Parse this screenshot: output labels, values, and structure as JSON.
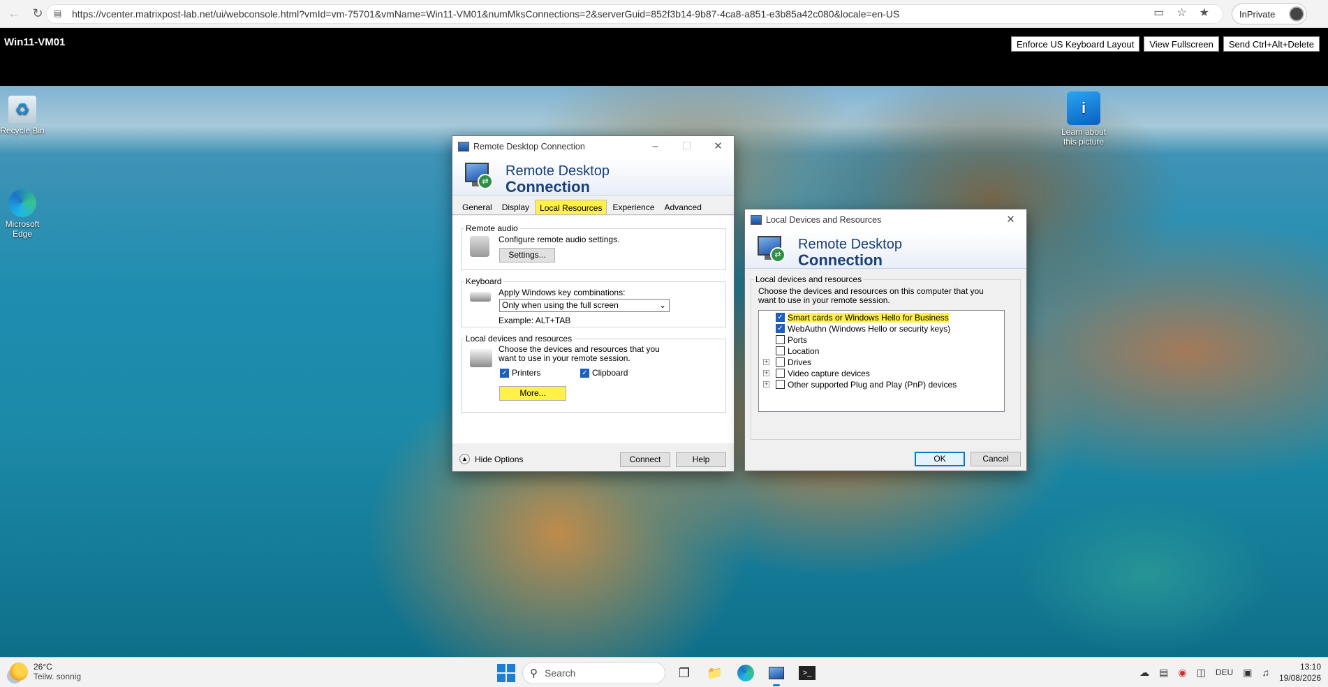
{
  "browser": {
    "url": "https://vcenter.matrixpost-lab.net/ui/webconsole.html?vmId=vm-75701&vmName=Win11-VM01&numMksConnections=2&serverGuid=852f3b14-9b87-4ca8-a851-e3b85a42c080&locale=en-US",
    "profile_label": "InPrivate"
  },
  "console": {
    "vm_name": "Win11-VM01",
    "buttons": [
      "Enforce US Keyboard Layout",
      "View Fullscreen",
      "Send Ctrl+Alt+Delete"
    ]
  },
  "desktop": {
    "icons": [
      {
        "label": "Recycle Bin",
        "icon": "recycle-bin-icon"
      },
      {
        "label": "Microsoft Edge",
        "icon": "edge-icon"
      },
      {
        "label": "Learn about this picture",
        "icon": "learn-icon"
      }
    ]
  },
  "rdc": {
    "title": "Remote Desktop Connection",
    "banner_line1": "Remote Desktop",
    "banner_line2": "Connection",
    "tabs": [
      "General",
      "Display",
      "Local Resources",
      "Experience",
      "Advanced"
    ],
    "active_tab": "Local Resources",
    "remote_audio": {
      "label": "Remote audio",
      "description": "Configure remote audio settings.",
      "button": "Settings..."
    },
    "keyboard": {
      "label": "Keyboard",
      "description": "Apply Windows key combinations:",
      "selected": "Only when using the full screen",
      "example": "Example: ALT+TAB"
    },
    "local_devices": {
      "label": "Local devices and resources",
      "description": "Choose the devices and resources that you want to use in your remote session.",
      "printers": "Printers",
      "clipboard": "Clipboard",
      "more_button": "More..."
    },
    "hide_options": "Hide Options",
    "connect": "Connect",
    "help": "Help"
  },
  "ldr": {
    "title": "Local Devices and Resources",
    "banner_line1": "Remote Desktop",
    "banner_line2": "Connection",
    "group_label": "Local devices and resources",
    "description": "Choose the devices and resources on this computer that you want to use in your remote session.",
    "items": [
      {
        "label": "Smart cards or Windows Hello for Business",
        "checked": true,
        "expandable": false
      },
      {
        "label": "WebAuthn (Windows Hello or security keys)",
        "checked": true,
        "expandable": false
      },
      {
        "label": "Ports",
        "checked": false,
        "expandable": false
      },
      {
        "label": "Location",
        "checked": false,
        "expandable": false
      },
      {
        "label": "Drives",
        "checked": false,
        "expandable": true
      },
      {
        "label": "Video capture devices",
        "checked": false,
        "expandable": true
      },
      {
        "label": "Other supported Plug and Play (PnP) devices",
        "checked": false,
        "expandable": true
      }
    ],
    "ok": "OK",
    "cancel": "Cancel"
  },
  "taskbar": {
    "temperature": "26°C",
    "weather": "Teilw. sonnig",
    "search_placeholder": "Search",
    "language": "DEU",
    "time": "13:10",
    "date": "19/08/2026"
  }
}
